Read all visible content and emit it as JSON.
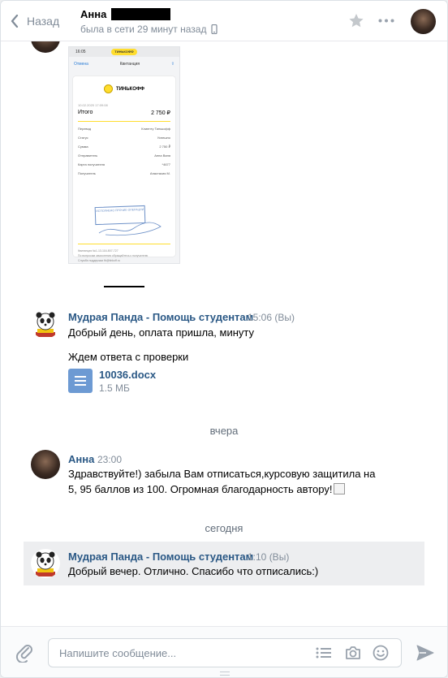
{
  "header": {
    "back_label": "Назад",
    "name": "Анна",
    "status": "была в сети 29 минут назад"
  },
  "receipt": {
    "status_time": "16:05",
    "pill": "ТИНЬКОФФ",
    "nav_left": "Отмена",
    "nav_title": "Квитанция",
    "brand": "ТИНЬКОФФ",
    "date": "10.02.2020 17:09:08",
    "total_label": "Итого",
    "total_value": "2 750 ₽",
    "rows": [
      {
        "k": "Перевод",
        "v": "Клиенту Тинькофф"
      },
      {
        "k": "Статус",
        "v": "Успешно"
      },
      {
        "k": "Сумма",
        "v": "2 750 ₽"
      },
      {
        "k": "Отправитель",
        "v": "Анна Ваня"
      },
      {
        "k": "Карта получателя",
        "v": "*4677"
      },
      {
        "k": "Получатель",
        "v": "Анастасия М."
      }
    ],
    "stamp": "ИСПОЛНЕНО ПРОЧИЕ ОПЕРАЦИИ",
    "footer_1": "Квитанция №1-13-116-807-727",
    "footer_2": "По вопросам зачисления обращайтесь к получателю",
    "footer_3": "Служба поддержки fb@tinkoff.ru"
  },
  "messages": [
    {
      "author": "Мудрая Панда - Помощь студентам",
      "time": "15:06 (Вы)",
      "text_1": "Добрый день, оплата пришла, минуту",
      "text_2": "Ждем ответа с проверки",
      "doc_name": "10036.docx",
      "doc_size": "1.5 МБ"
    },
    {
      "author": "Анна",
      "time": "23:00",
      "text_1": "Здравствуйте!) забыла Вам отписаться,курсовую защитила на",
      "text_2": "5, 95 баллов из 100. Огромная благодарность автору!"
    },
    {
      "author": "Мудрая Панда - Помощь студентам",
      "time": "1:10 (Вы)",
      "text_1": "Добрый вечер. Отлично. Спасибо что отписались:)"
    }
  ],
  "dates": {
    "yesterday": "вчера",
    "today": "сегодня"
  },
  "composer": {
    "placeholder": "Напишите сообщение..."
  },
  "icons": [
    "chevron-left-icon",
    "phone-icon",
    "star-icon",
    "more-icon",
    "attach-icon",
    "list-icon",
    "camera-icon",
    "smile-icon",
    "send-icon",
    "document-icon"
  ],
  "colors": {
    "link": "#2a5885",
    "muted": "#818c99",
    "highlight": "#edeef0",
    "doc_icon": "#6d9ad3"
  }
}
